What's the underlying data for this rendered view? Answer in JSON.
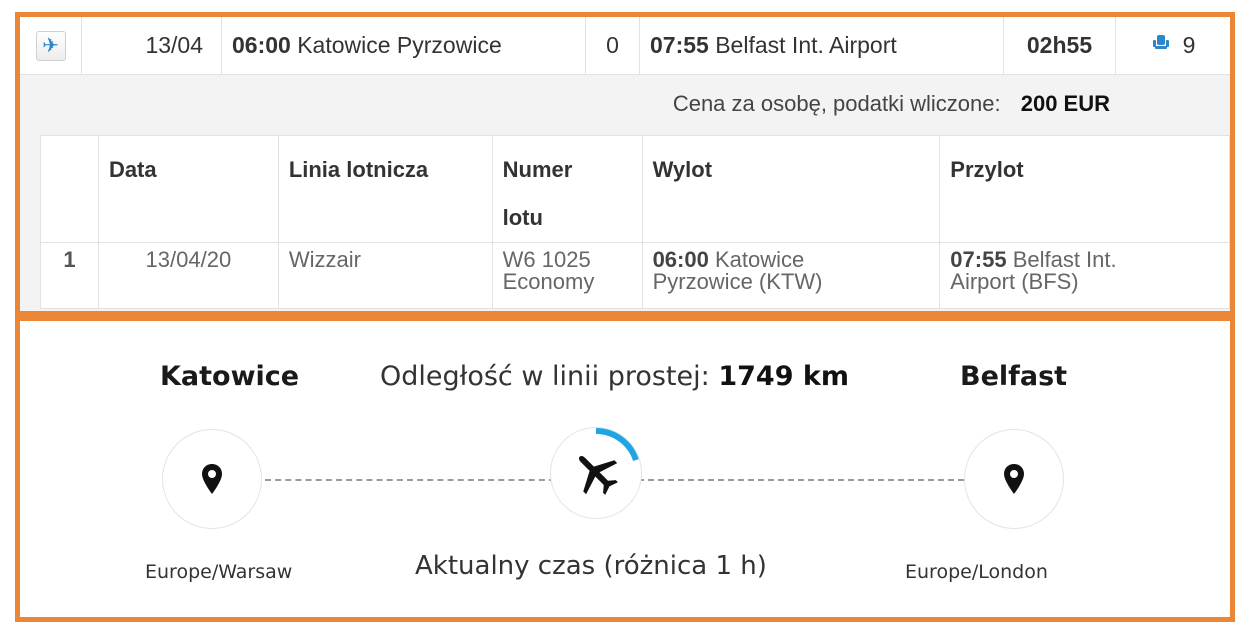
{
  "summary": {
    "date": "13/04",
    "departure_time": "06:00",
    "departure_airport": "Katowice Pyrzowice",
    "stops": "0",
    "arrival_time": "07:55",
    "arrival_airport": "Belfast Int. Airport",
    "duration": "02h55",
    "seats": "9"
  },
  "price": {
    "label": "Cena za osobę, podatki wliczone:",
    "value": "200 EUR"
  },
  "table": {
    "headers": {
      "date": "Data",
      "airline": "Linia lotnicza",
      "flight_number_1": "Numer",
      "flight_number_2": "lotu",
      "departure": "Wylot",
      "arrival": "Przylot"
    },
    "rows": [
      {
        "index": "1",
        "date": "13/04/20",
        "airline": "Wizzair",
        "flight_number": "W6 1025",
        "cabin": "Economy",
        "dep_time": "06:00",
        "dep_city": "Katowice",
        "dep_airport": "Pyrzowice (KTW)",
        "arr_time": "07:55",
        "arr_city": "Belfast Int.",
        "arr_airport": "Airport (BFS)"
      }
    ]
  },
  "route": {
    "from_city": "Katowice",
    "to_city": "Belfast",
    "distance_label": "Odległość w linii prostej:",
    "distance_value": "1749 km",
    "from_timezone": "Europe/Warsaw",
    "to_timezone": "Europe/London",
    "current_time_label": "Aktualny czas (różnica 1 h)",
    "progress_fraction": 0.2
  },
  "colors": {
    "frame": "#ea8635",
    "accent": "#2d86c9",
    "progress": "#1fa5e6"
  },
  "icons": {
    "flight_type": "plane-icon",
    "seats": "seat-icon",
    "location": "map-pin-icon",
    "in_flight": "airplane-icon"
  }
}
